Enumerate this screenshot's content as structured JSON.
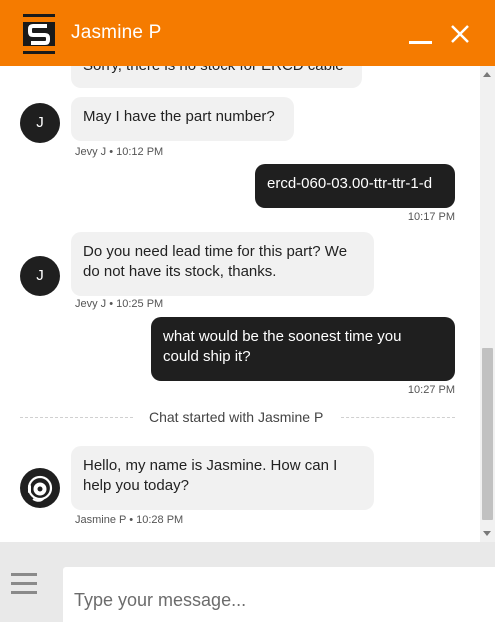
{
  "header": {
    "title": "Jasmine P",
    "logo_icon": "stacked-s-logo-icon",
    "minimize_icon": "minimize-icon",
    "close_icon": "close-icon",
    "accent_color": "#f57b00"
  },
  "messages": [
    {
      "direction": "in",
      "text": "Sorry, there is no stock for ERCD cable"
    },
    {
      "direction": "in",
      "avatar": "J",
      "text": "May I have the part number?",
      "meta": "Jevy J • 10:12 PM"
    },
    {
      "direction": "out",
      "text": "ercd-060-03.00-ttr-ttr-1-d",
      "meta": "10:17 PM"
    },
    {
      "direction": "in",
      "avatar": "J",
      "text_line1": "Do you need lead time for this part? We",
      "text_line2": "do not have its stock, thanks.",
      "meta": "Jevy J • 10:25 PM"
    },
    {
      "direction": "out",
      "text_line1": "what would be the soonest time you",
      "text_line2": "could ship it?",
      "meta": "10:27 PM"
    },
    {
      "direction": "in",
      "avatar_icon": "agent-headset-icon",
      "text_line1": "Hello, my name is Jasmine. How can I",
      "text_line2": "help you today?",
      "meta": "Jasmine P • 10:28 PM"
    }
  ],
  "divider": {
    "text": "Chat started with Jasmine P"
  },
  "composer": {
    "placeholder": "Type your message...",
    "menu_icon": "hamburger-menu-icon"
  }
}
